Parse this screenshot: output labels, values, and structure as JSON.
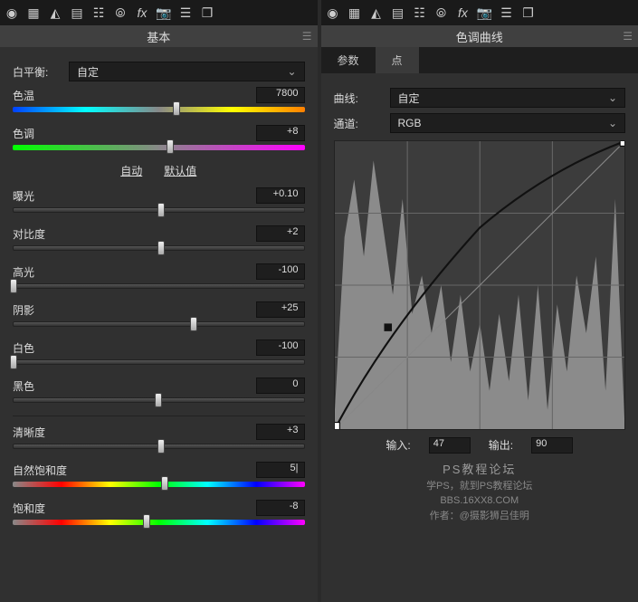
{
  "left": {
    "title": "基本",
    "wb_label": "白平衡:",
    "wb_value": "自定",
    "auto": "自动",
    "default": "默认值",
    "sliders": {
      "temp": {
        "label": "色温",
        "value": "7800",
        "pos": 56
      },
      "tint": {
        "label": "色调",
        "value": "+8",
        "pos": 54
      },
      "exposure": {
        "label": "曝光",
        "value": "+0.10",
        "pos": 51
      },
      "contrast": {
        "label": "对比度",
        "value": "+2",
        "pos": 51
      },
      "highlights": {
        "label": "高光",
        "value": "-100",
        "pos": 0
      },
      "shadows": {
        "label": "阴影",
        "value": "+25",
        "pos": 62
      },
      "whites": {
        "label": "白色",
        "value": "-100",
        "pos": 0
      },
      "blacks": {
        "label": "黑色",
        "value": "0",
        "pos": 50
      },
      "clarity": {
        "label": "清晰度",
        "value": "+3",
        "pos": 51
      },
      "vibrance": {
        "label": "自然饱和度",
        "value": "5|",
        "pos": 52
      },
      "saturation": {
        "label": "饱和度",
        "value": "-8",
        "pos": 46
      }
    }
  },
  "right": {
    "title": "色调曲线",
    "tab_param": "参数",
    "tab_point": "点",
    "curve_label": "曲线:",
    "curve_value": "自定",
    "channel_label": "通道:",
    "channel_value": "RGB",
    "input_label": "输入:",
    "input_value": "47",
    "output_label": "输出:",
    "output_value": "90"
  },
  "footer": {
    "t1": "PS教程论坛",
    "t2": "学PS，就到PS教程论坛",
    "t3": "BBS.16XX8.COM",
    "t4": "作者：@摄影狮吕佳明"
  },
  "chart_data": {
    "type": "line",
    "title": "Tone Curve",
    "xlabel": "输入",
    "ylabel": "输出",
    "xlim": [
      0,
      255
    ],
    "ylim": [
      0,
      255
    ],
    "series": [
      {
        "name": "curve",
        "x": [
          0,
          47,
          128,
          200,
          255
        ],
        "y": [
          0,
          90,
          180,
          230,
          255
        ]
      }
    ],
    "point": {
      "input": 47,
      "output": 90
    }
  }
}
